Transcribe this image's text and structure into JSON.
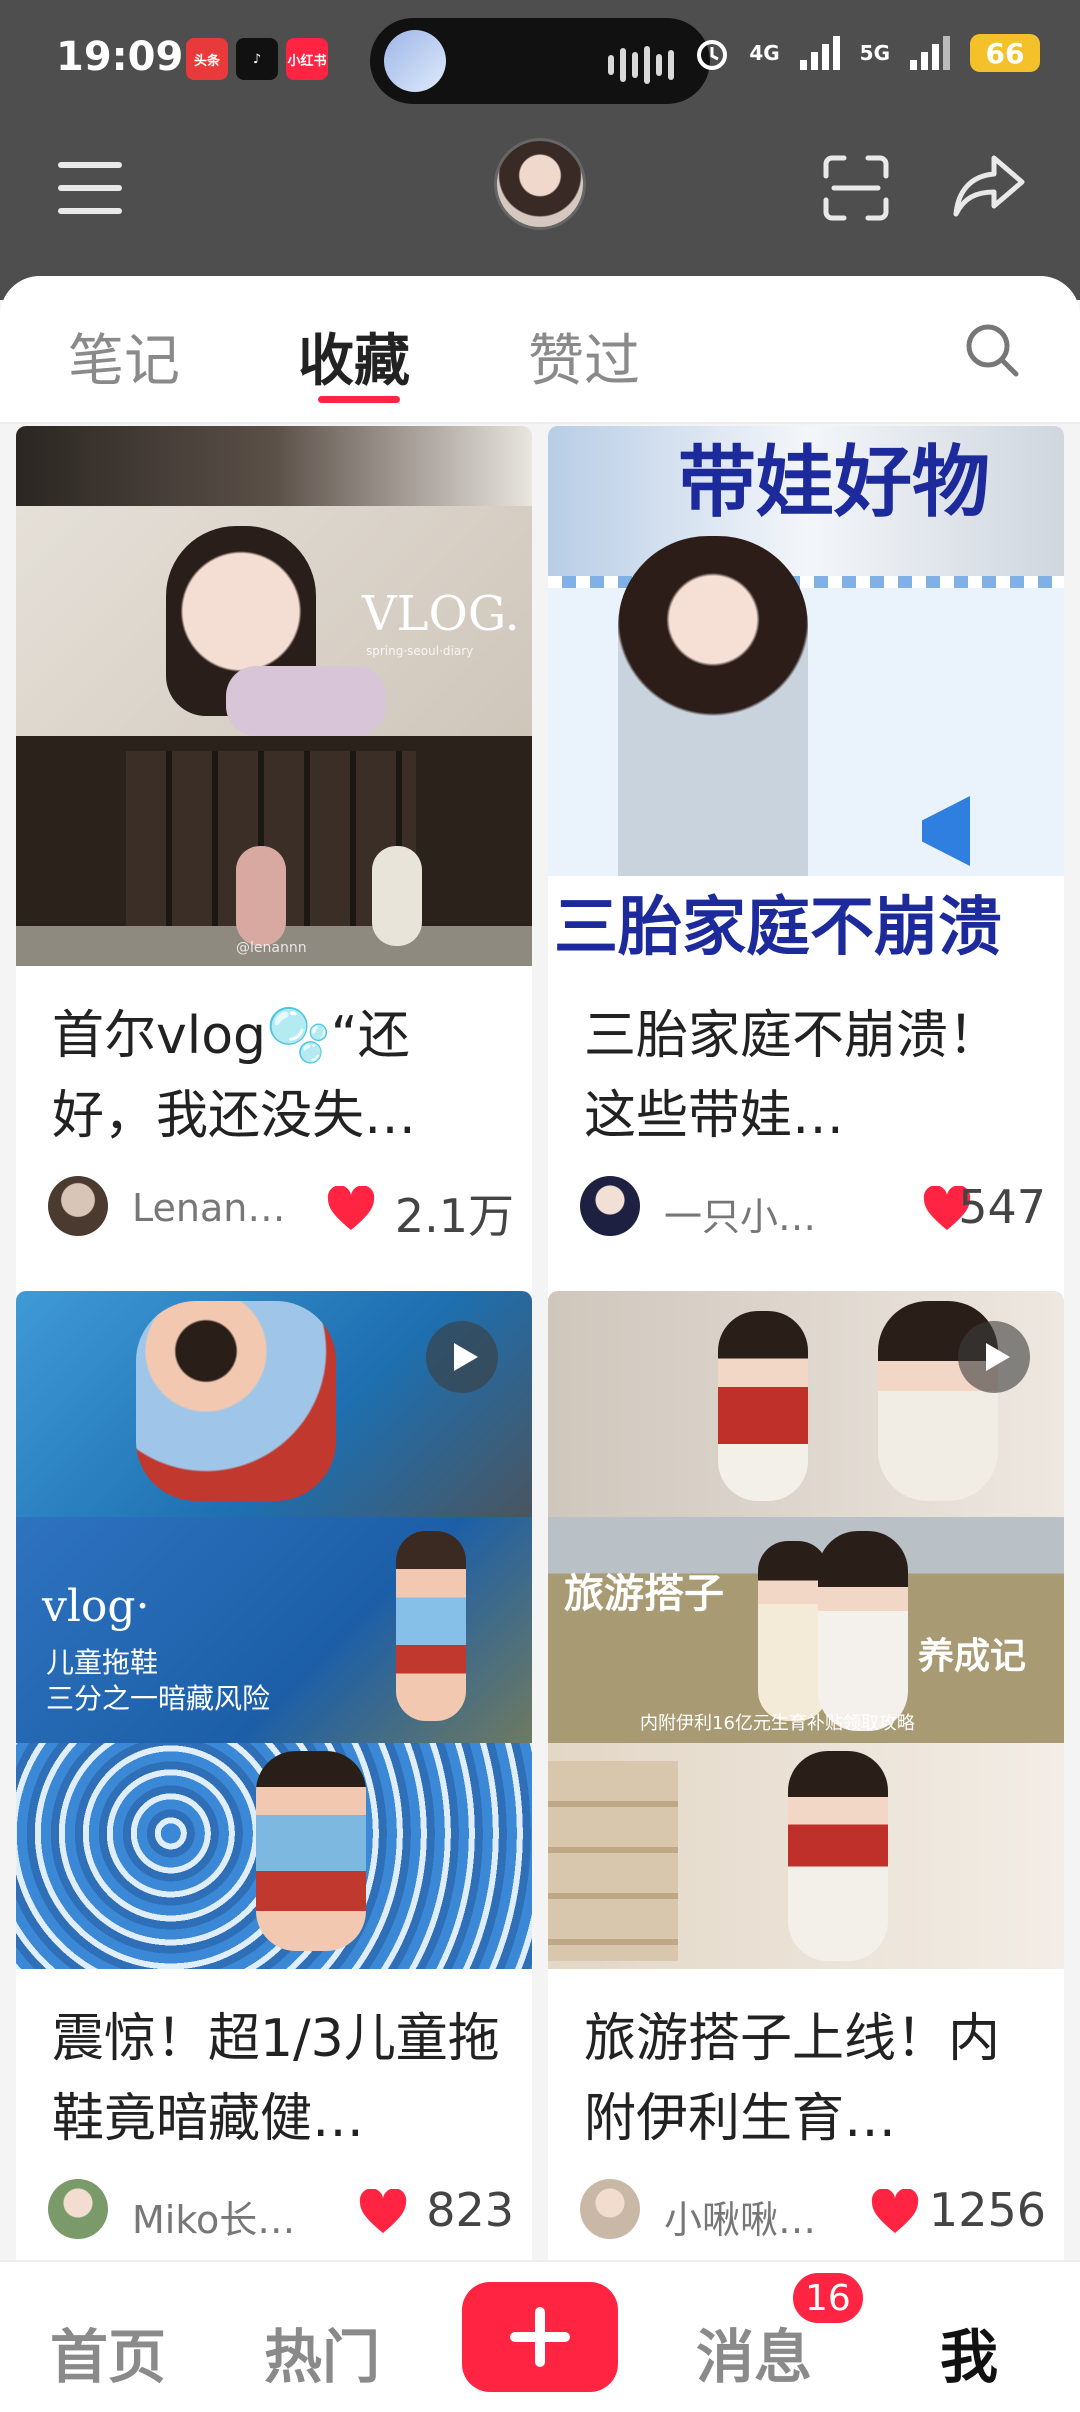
{
  "status_bar": {
    "time": "19:09",
    "apps": [
      "头条",
      "抖音",
      "小红书"
    ],
    "network_1": "4G",
    "network_2": "5G",
    "battery": "66"
  },
  "header": {
    "menu_icon": "menu-icon",
    "scan_icon": "scan-icon",
    "share_icon": "share-icon"
  },
  "tabs": {
    "items": [
      "笔记",
      "收藏",
      "赞过"
    ],
    "active_index": 1,
    "accent": "#ff2442"
  },
  "cards": [
    {
      "title": "首尔vlog🫧“还好，我还没失…",
      "author": "Lenan…",
      "likes": "2.1万",
      "overlay": "VLOG.",
      "overlay_sub": "spring·seoul·diary",
      "watermark": "@lenannn"
    },
    {
      "title": "三胎家庭不崩溃！这些带娃…",
      "author": "一只小…",
      "likes": "547",
      "overlay_top": "带娃好物",
      "overlay_bottom": "三胎家庭不崩溃"
    },
    {
      "title": "震惊！超1/3儿童拖鞋竟暗藏健…",
      "author": "Miko长…",
      "likes": "823",
      "overlay": "vlog·",
      "overlay_sub1": "儿童拖鞋",
      "overlay_sub2": "三分之一暗藏风险",
      "has_video": true
    },
    {
      "title": "旅游搭子上线！内附伊利生育…",
      "author": "小啾啾…",
      "likes": "1256",
      "overlay_left": "旅游搭子",
      "overlay_right": "养成记",
      "overlay_line": "内附伊利16亿元生育补贴领取攻略",
      "has_video": true
    }
  ],
  "bottom_nav": {
    "items": [
      "首页",
      "热门",
      "消息",
      "我"
    ],
    "active": "我",
    "message_badge": "16"
  }
}
